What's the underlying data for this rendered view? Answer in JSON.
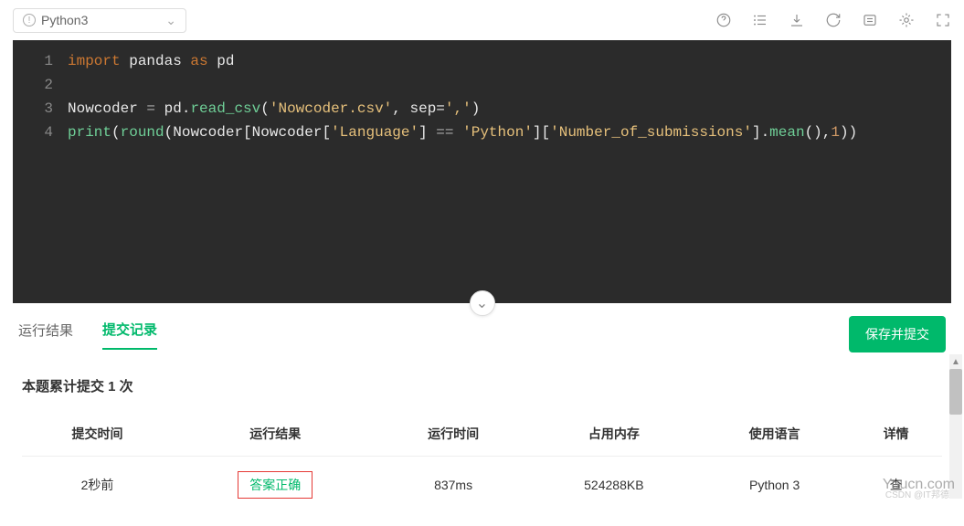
{
  "header": {
    "language_selector": "Python3"
  },
  "code": {
    "lines": [
      {
        "n": 1,
        "tokens": [
          [
            "kw-import",
            "import"
          ],
          [
            "id",
            " pandas "
          ],
          [
            "kw-as",
            "as"
          ],
          [
            "id",
            " pd"
          ]
        ]
      },
      {
        "n": 2,
        "tokens": []
      },
      {
        "n": 3,
        "tokens": [
          [
            "id",
            "Nowcoder "
          ],
          [
            "assign",
            "="
          ],
          [
            "id",
            " pd."
          ],
          [
            "func",
            "read_csv"
          ],
          [
            "id",
            "("
          ],
          [
            "str",
            "'Nowcoder.csv'"
          ],
          [
            "id",
            ", sep="
          ],
          [
            "str",
            "','"
          ],
          [
            "id",
            ")"
          ]
        ]
      },
      {
        "n": 4,
        "tokens": [
          [
            "builtin",
            "print"
          ],
          [
            "id",
            "("
          ],
          [
            "builtin",
            "round"
          ],
          [
            "id",
            "(Nowcoder[Nowcoder["
          ],
          [
            "str",
            "'Language'"
          ],
          [
            "id",
            "] "
          ],
          [
            "assign",
            "=="
          ],
          [
            "id",
            " "
          ],
          [
            "str",
            "'Python'"
          ],
          [
            "id",
            "]["
          ],
          [
            "str",
            "'Number_of_submissions'"
          ],
          [
            "id",
            "]."
          ],
          [
            "func",
            "mean"
          ],
          [
            "id",
            "(),"
          ],
          [
            "num",
            "1"
          ],
          [
            "id",
            "))"
          ]
        ]
      }
    ]
  },
  "tabs": {
    "result_label": "运行结果",
    "history_label": "提交记录",
    "submit_button": "保存并提交"
  },
  "submission": {
    "summary": "本题累计提交 1 次",
    "columns": [
      "提交时间",
      "运行结果",
      "运行时间",
      "占用内存",
      "使用语言",
      "详情"
    ],
    "row": {
      "time": "2秒前",
      "result": "答案正确",
      "runtime": "837ms",
      "memory": "524288KB",
      "language": "Python 3",
      "detail": "查"
    }
  },
  "watermark": {
    "main": "Yuucn.com",
    "sub": "CSDN @IT邦德"
  }
}
